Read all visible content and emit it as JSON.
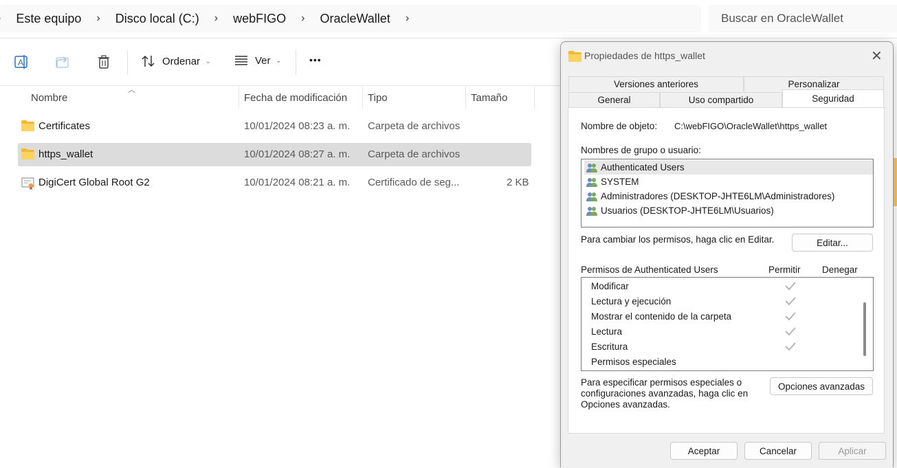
{
  "address": {
    "crumbs": [
      "Este equipo",
      "Disco local (C:)",
      "webFIGO",
      "OracleWallet"
    ],
    "search_placeholder": "Buscar en OracleWallet"
  },
  "toolbar": {
    "sort_label": "Ordenar",
    "view_label": "Ver",
    "more_label": "•••"
  },
  "columns": {
    "name": "Nombre",
    "modified": "Fecha de modificación",
    "type": "Tipo",
    "size": "Tamaño"
  },
  "files": [
    {
      "name": "Certificates",
      "modified": "10/01/2024 08:23 a. m.",
      "type": "Carpeta de archivos",
      "size": "",
      "icon": "folder-icon"
    },
    {
      "name": "https_wallet",
      "modified": "10/01/2024 08:27 a. m.",
      "type": "Carpeta de archivos",
      "size": "",
      "icon": "folder-icon"
    },
    {
      "name": "DigiCert Global Root G2",
      "modified": "10/01/2024 08:21 a. m.",
      "type": "Certificado de seg...",
      "size": "2 KB",
      "icon": "certificate-icon"
    }
  ],
  "dialog": {
    "title": "Propiedades de https_wallet",
    "tabs": {
      "prev_versions": "Versiones anteriores",
      "customize": "Personalizar",
      "general": "General",
      "sharing": "Uso compartido",
      "security": "Seguridad"
    },
    "object_name_label": "Nombre de objeto:",
    "object_name_value": "C:\\webFIGO\\OracleWallet\\https_wallet",
    "groups_label": "Nombres de grupo o usuario:",
    "groups": [
      "Authenticated Users",
      "SYSTEM",
      "Administradores (DESKTOP-JHTE6LM\\Administradores)",
      "Usuarios (DESKTOP-JHTE6LM\\Usuarios)"
    ],
    "change_perms_text": "Para cambiar los permisos, haga clic en Editar.",
    "edit_button": "Editar...",
    "perms_header": "Permisos de Authenticated Users",
    "allow_header": "Permitir",
    "deny_header": "Denegar",
    "permissions": [
      {
        "name": "Modificar",
        "allow": true
      },
      {
        "name": "Lectura y ejecución",
        "allow": true
      },
      {
        "name": "Mostrar el contenido de la carpeta",
        "allow": true
      },
      {
        "name": "Lectura",
        "allow": true
      },
      {
        "name": "Escritura",
        "allow": true
      },
      {
        "name": "Permisos especiales",
        "allow": false
      }
    ],
    "advanced_text": [
      "Para especificar permisos especiales o",
      "configuraciones avanzadas, haga clic en",
      "Opciones avanzadas."
    ],
    "advanced_button": "Opciones avanzadas",
    "ok_button": "Aceptar",
    "cancel_button": "Cancelar",
    "apply_button": "Aplicar"
  }
}
